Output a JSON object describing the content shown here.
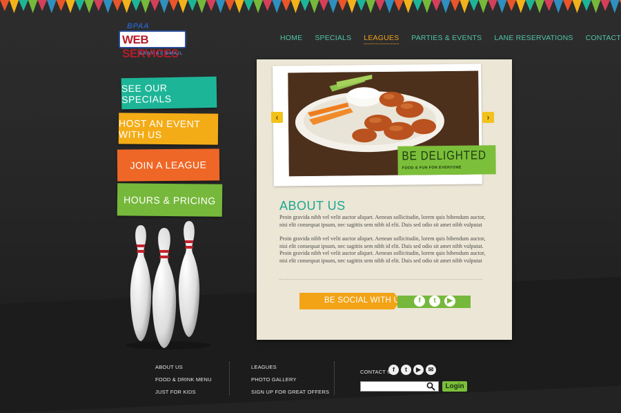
{
  "logo": {
    "mark": "BPAA",
    "name": "WEB SERVICES",
    "tagline": "EASY AS EMAIL"
  },
  "nav": {
    "items": [
      {
        "label": "Home",
        "active": false
      },
      {
        "label": "Specials",
        "active": false
      },
      {
        "label": "Leagues",
        "active": true
      },
      {
        "label": "Parties & Events",
        "active": false
      },
      {
        "label": "Lane Reservations",
        "active": false
      },
      {
        "label": "Contact Us",
        "active": false
      }
    ]
  },
  "side_buttons": {
    "specials": "See Our Specials",
    "event": "Host an Event With Us",
    "league": "Join a League",
    "hours": "Hours & Pricing"
  },
  "slider": {
    "prev": "‹",
    "next": "›",
    "title": "BE DELIGHTED",
    "subtitle": "FOOD & FUN FOR EVERYONE"
  },
  "about": {
    "title": "ABOUT US",
    "para1": "Proin gravida nibh vel velit auctor aliquet. Aenean sollicitudin, lorem quis bibendum auctor, nisi elit consequat ipsum, nec sagittis sem nibh id elit. Duis sed odio sit amet nibh vulputat",
    "para2": "Proin gravida nibh vel velit auctor aliquet. Aenean sollicitudin, lorem quis bibendum auctor, nisi elit consequat ipsum, nec sagittis sem nibh id elit. Duis sed odio sit amet nibh vulputat.",
    "para3": "Proin gravida nibh vel velit auctor aliquet. Aenean sollicitudin, lorem quis bibendum auctor, nisi elit consequat ipsum, nec sagittis sem nibh id elit. Duis sed odio sit amet nibh vulputat"
  },
  "social": {
    "label": "Be Social With Us",
    "facebook": "f",
    "twitter": "t",
    "youtube": "▶"
  },
  "footer": {
    "col1": [
      "ABOUT US",
      "FOOD & DRINK MENU",
      "JUST FOR KIDS"
    ],
    "col2": [
      "LEAGUES",
      "PHOTO GALLERY",
      "SIGN UP FOR GREAT OFFERS"
    ],
    "contact_label": "CONTACT US",
    "icons": {
      "facebook": "f",
      "twitter": "t",
      "youtube": "▶",
      "email": "✉"
    },
    "search": {
      "value": "",
      "placeholder": ""
    },
    "login": "Login"
  },
  "colors": {
    "teal": "#1db597",
    "yellow": "#f4ac16",
    "orange": "#ef6726",
    "green": "#76b83b",
    "card": "#ece6d6",
    "nav": "#52c4a6",
    "nav_active": "#f0a21b"
  }
}
